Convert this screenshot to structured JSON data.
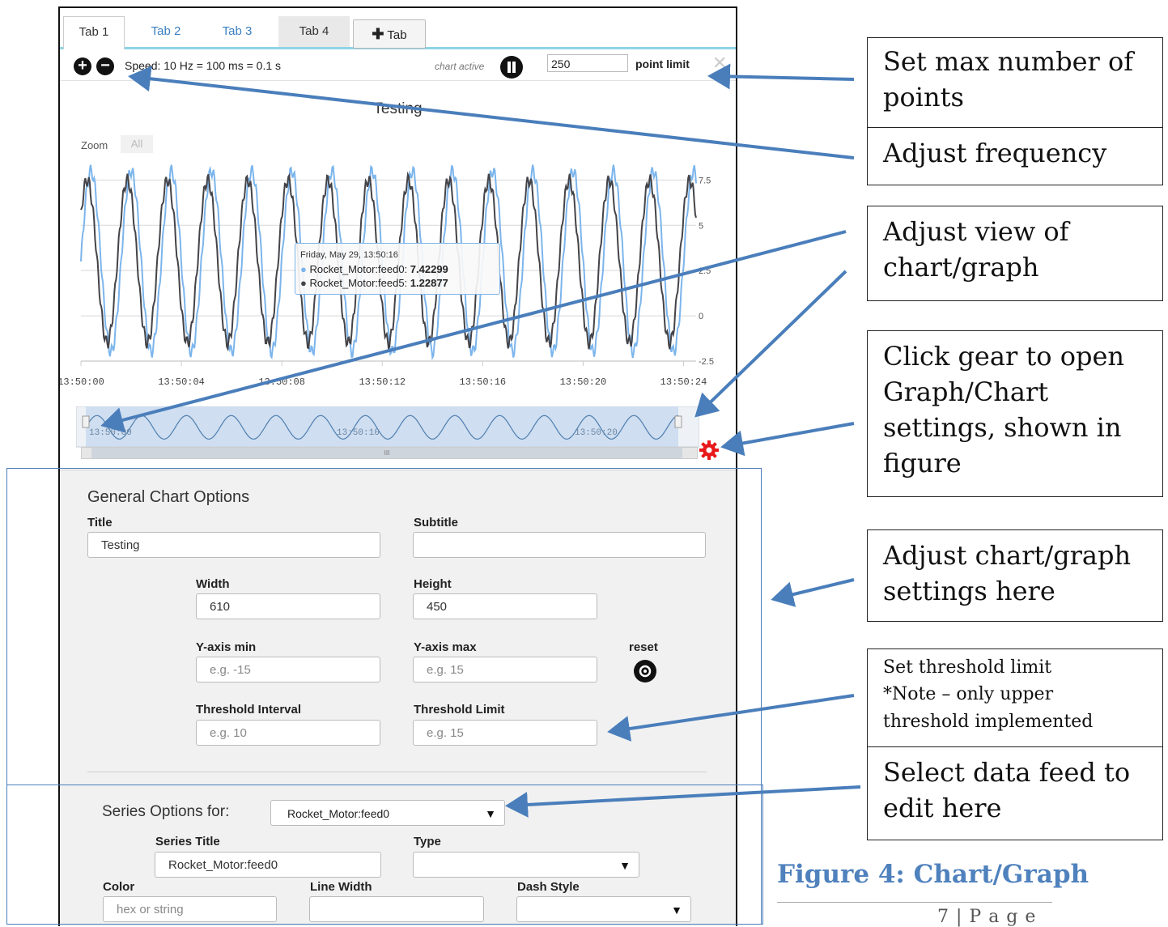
{
  "tabs": [
    {
      "label": "Tab 1"
    },
    {
      "label": "Tab 2"
    },
    {
      "label": "Tab 3"
    },
    {
      "label": "Tab 4"
    }
  ],
  "add_tab": {
    "label": "Tab",
    "icon": "plus-icon"
  },
  "toolbar": {
    "speed_text": "Speed: 10 Hz = 100 ms = 0.1 s",
    "chart_active_label": "chart active",
    "point_limit_value": "250",
    "point_limit_label": "point limit",
    "close_glyph": "✕"
  },
  "chart": {
    "zoom_label": "Zoom",
    "zoom_all": "All",
    "tooltip": {
      "date": "Friday, May 29, 13:50:16",
      "rows": [
        {
          "name": "Rocket_Motor:feed0:",
          "value": "7.42299",
          "color": "#7cb5ec"
        },
        {
          "name": "Rocket_Motor:feed5:",
          "value": "1.22877",
          "color": "#434348"
        }
      ]
    },
    "navigator_labels": [
      "13:50:00",
      "13:50:10",
      "13:50:20"
    ],
    "scroll_mark": "III"
  },
  "chart_data": {
    "type": "line",
    "title": "Testing",
    "x_ticks": [
      "13:50:00",
      "13:50:04",
      "13:50:08",
      "13:50:12",
      "13:50:16",
      "13:50:20",
      "13:50:24"
    ],
    "y_ticks": [
      "7.5",
      "5",
      "2.5",
      "0",
      "-2.5"
    ],
    "ylim": [
      -2.5,
      8.5
    ],
    "grid": true,
    "series": [
      {
        "name": "Rocket_Motor:feed0",
        "color": "#7cb5ec",
        "period_s": 1.6,
        "amplitude": 5,
        "center": 3
      },
      {
        "name": "Rocket_Motor:feed5",
        "color": "#434348",
        "period_s": 1.6,
        "amplitude": 4.5,
        "center": 3
      }
    ]
  },
  "general": {
    "heading": "General Chart Options",
    "title_label": "Title",
    "title_value": "Testing",
    "subtitle_label": "Subtitle",
    "subtitle_value": "",
    "width_label": "Width",
    "width_value": "610",
    "height_label": "Height",
    "height_value": "450",
    "ymin_label": "Y-axis min",
    "ymin_placeholder": "e.g. -15",
    "ymax_label": "Y-axis max",
    "ymax_placeholder": "e.g. 15",
    "reset_label": "reset",
    "threshold_interval_label": "Threshold Interval",
    "threshold_interval_placeholder": "e.g. 10",
    "threshold_limit_label": "Threshold Limit",
    "threshold_limit_placeholder": "e.g. 15"
  },
  "series_options": {
    "heading": "Series Options for:",
    "selected_feed": "Rocket_Motor:feed0",
    "series_title_label": "Series Title",
    "series_title_value": "Rocket_Motor:feed0",
    "type_label": "Type",
    "type_value": "",
    "color_label": "Color",
    "color_placeholder": "hex or string",
    "line_width_label": "Line Width",
    "dash_style_label": "Dash Style"
  },
  "callouts": {
    "max_points": [
      "Set max number of",
      "points"
    ],
    "frequency": [
      "Adjust frequency"
    ],
    "view": [
      "Adjust view of",
      "chart/graph"
    ],
    "gear": [
      "Click gear to open",
      "Graph/Chart",
      "settings, shown in",
      "figure"
    ],
    "settings": [
      "Adjust chart/graph",
      "settings here"
    ],
    "threshold": [
      "Set threshold limit",
      "*Note – only upper",
      "threshold implemented"
    ],
    "feed": [
      "Select data feed to",
      "edit here"
    ]
  },
  "figure_caption": "Figure 4: Chart/Graph",
  "page_number": "7 | P a g e",
  "colors": {
    "accent": "#4a7ebb",
    "gear": "#e8191a",
    "tab_underline": "#8fd4e6",
    "caption": "#4f81bd"
  }
}
